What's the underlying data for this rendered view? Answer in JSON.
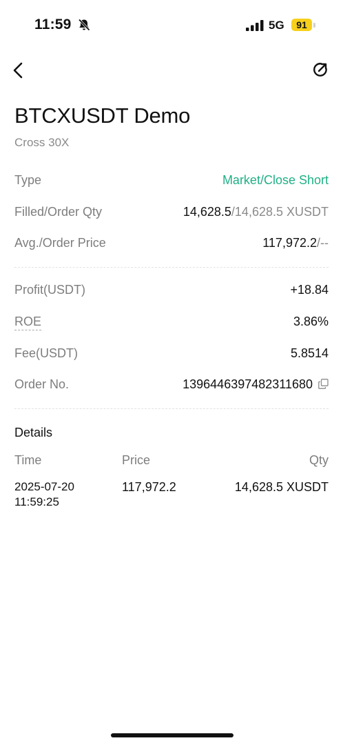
{
  "status_bar": {
    "time": "11:59",
    "network": "5G",
    "battery": "91",
    "icons": [
      "bell-slash-icon",
      "signal-icon"
    ]
  },
  "nav": {
    "icons": [
      "back-chevron-icon",
      "share-icon"
    ]
  },
  "header": {
    "title": "BTCXUSDT Demo",
    "subtitle": "Cross 30X"
  },
  "summary": {
    "type_label": "Type",
    "type_value": "Market/Close Short",
    "type_color": "#1fb085",
    "filled_label": "Filled/Order Qty",
    "filled_value": "14,628.5",
    "filled_sep_order": "/14,628.5 XUSDT",
    "avg_label": "Avg./Order Price",
    "avg_value": "117,972.2",
    "avg_sep_order": "/--"
  },
  "result": {
    "profit_label": "Profit(USDT)",
    "profit_value": "+18.84",
    "roe_label": "ROE",
    "roe_value": "3.86%",
    "fee_label": "Fee(USDT)",
    "fee_value": "5.8514",
    "order_no_label": "Order No.",
    "order_no_value": "1396446397482311680"
  },
  "details": {
    "heading": "Details",
    "columns": [
      "Time",
      "Price",
      "Qty"
    ],
    "rows": [
      {
        "date": "2025-07-20",
        "time": "11:59:25",
        "price": "117,972.2",
        "qty": "14,628.5 XUSDT"
      }
    ]
  }
}
